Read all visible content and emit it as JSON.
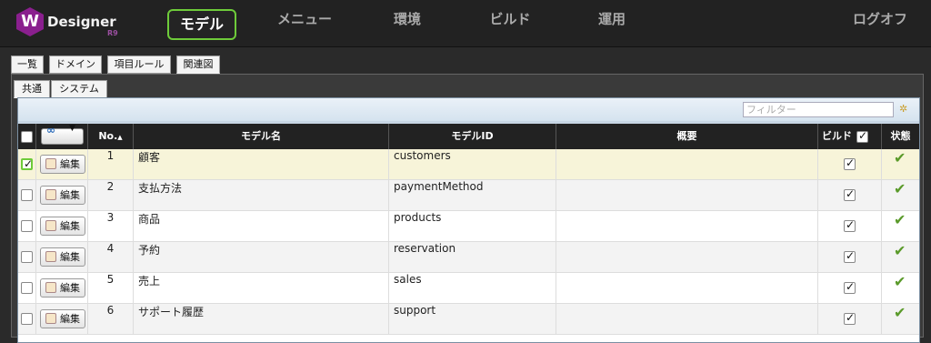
{
  "app": {
    "brand": "Designer",
    "brand_prefix": "W",
    "version": "R9"
  },
  "nav": {
    "items": [
      "モデル",
      "メニュー",
      "環境",
      "ビルド",
      "運用"
    ],
    "logout": "ログオフ"
  },
  "subtabs": [
    "一覧",
    "ドメイン",
    "項目ルール",
    "関連図"
  ],
  "tabs2": [
    "共通",
    "システム"
  ],
  "filter": {
    "placeholder": "フィルター"
  },
  "grid": {
    "headers": {
      "no": "No.",
      "name": "モデル名",
      "id": "モデルID",
      "summary": "概要",
      "build": "ビルド",
      "status": "状態"
    },
    "edit_label": "編集",
    "rows": [
      {
        "no": "1",
        "name": "顧客",
        "id": "customers",
        "checked": true
      },
      {
        "no": "2",
        "name": "支払方法",
        "id": "paymentMethod",
        "checked": false
      },
      {
        "no": "3",
        "name": "商品",
        "id": "products",
        "checked": false
      },
      {
        "no": "4",
        "name": "予約",
        "id": "reservation",
        "checked": false
      },
      {
        "no": "5",
        "name": "売上",
        "id": "sales",
        "checked": false
      },
      {
        "no": "6",
        "name": "サポート履歴",
        "id": "support",
        "checked": false
      }
    ]
  }
}
